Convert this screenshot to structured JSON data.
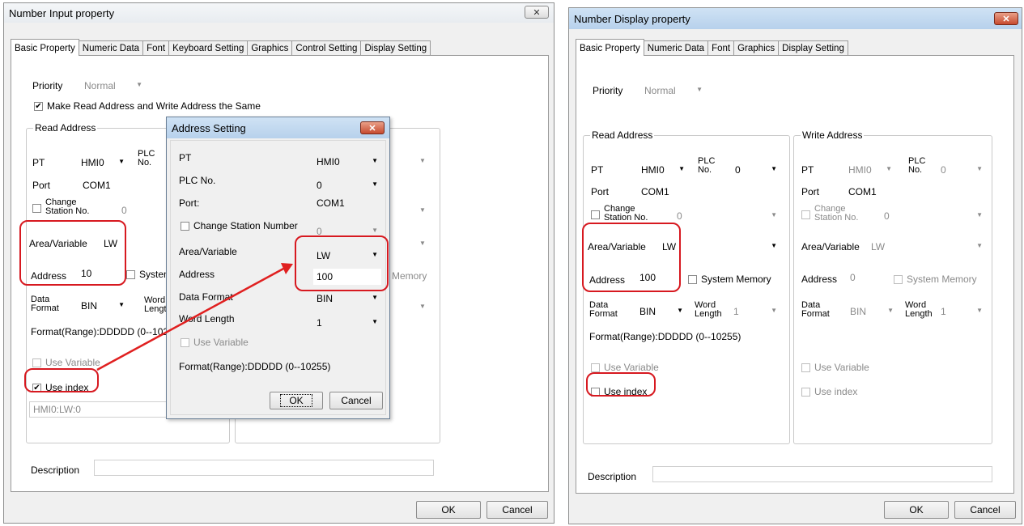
{
  "left": {
    "title": "Number Input property",
    "close": "✕",
    "tabs": [
      "Basic Property",
      "Numeric Data",
      "Font",
      "Keyboard Setting",
      "Graphics",
      "Control Setting",
      "Display Setting"
    ],
    "priority_label": "Priority",
    "priority_value": "Normal",
    "same_addr_label": "Make Read Address and Write Address the Same",
    "read_group": "Read Address",
    "pt_label": "PT",
    "pt_value": "HMI0",
    "plc_label": "PLC No.",
    "port_label": "Port",
    "port_value": "COM1",
    "change_station": "Change Station No.",
    "station_value": "0",
    "area_label": "Area/Variable",
    "area_value": "LW",
    "address_label": "Address",
    "address_value": "10",
    "system_label": "Systen",
    "memory_frag": "Memory",
    "data_format_label": "Data Format",
    "data_format_value": "BIN",
    "word_length_label": "Word Length",
    "format_range": "Format(Range):DDDDD (0--1025",
    "use_variable": "Use Variable",
    "use_index": "Use index",
    "index_value": "HMI0:LW:0",
    "description_label": "Description",
    "ok": "OK",
    "cancel": "Cancel"
  },
  "dialog": {
    "title": "Address Setting",
    "close": "✕",
    "pt_label": "PT",
    "pt_value": "HMI0",
    "plc_label": "PLC No.",
    "plc_value": "0",
    "port_label": "Port:",
    "port_value": "COM1",
    "change_station": "Change Station Number",
    "station_value": "0",
    "area_label": "Area/Variable",
    "area_value": "LW",
    "address_label": "Address",
    "address_value": "100",
    "data_format_label": "Data Format",
    "data_format_value": "BIN",
    "word_length_label": "Word Length",
    "word_length_value": "1",
    "use_variable": "Use Variable",
    "format_range": "Format(Range):DDDDD (0--10255)",
    "ok": "OK",
    "cancel": "Cancel"
  },
  "right": {
    "title": "Number Display property",
    "close": "✕",
    "tabs": [
      "Basic Property",
      "Numeric Data",
      "Font",
      "Graphics",
      "Display Setting"
    ],
    "priority_label": "Priority",
    "priority_value": "Normal",
    "read_group": "Read Address",
    "write_group": "Write Address",
    "pt_label": "PT",
    "pt_value": "HMI0",
    "plc_label": "PLC No.",
    "plc_value": "0",
    "port_label": "Port",
    "port_value": "COM1",
    "change_station": "Change Station No.",
    "station_value": "0",
    "area_label": "Area/Variable",
    "area_value": "LW",
    "address_label": "Address",
    "read_address_value": "100",
    "write_address_value": "0",
    "system_memory": "System Memory",
    "data_format_label": "Data Format",
    "data_format_value": "BIN",
    "word_length_label": "Word Length",
    "word_length_value": "1",
    "format_range": "Format(Range):DDDDD (0--10255)",
    "use_variable": "Use Variable",
    "use_index": "Use index",
    "description_label": "Description",
    "ok": "OK",
    "cancel": "Cancel"
  },
  "colors": {
    "highlight": "#d71920",
    "arrow": "#e02020"
  }
}
